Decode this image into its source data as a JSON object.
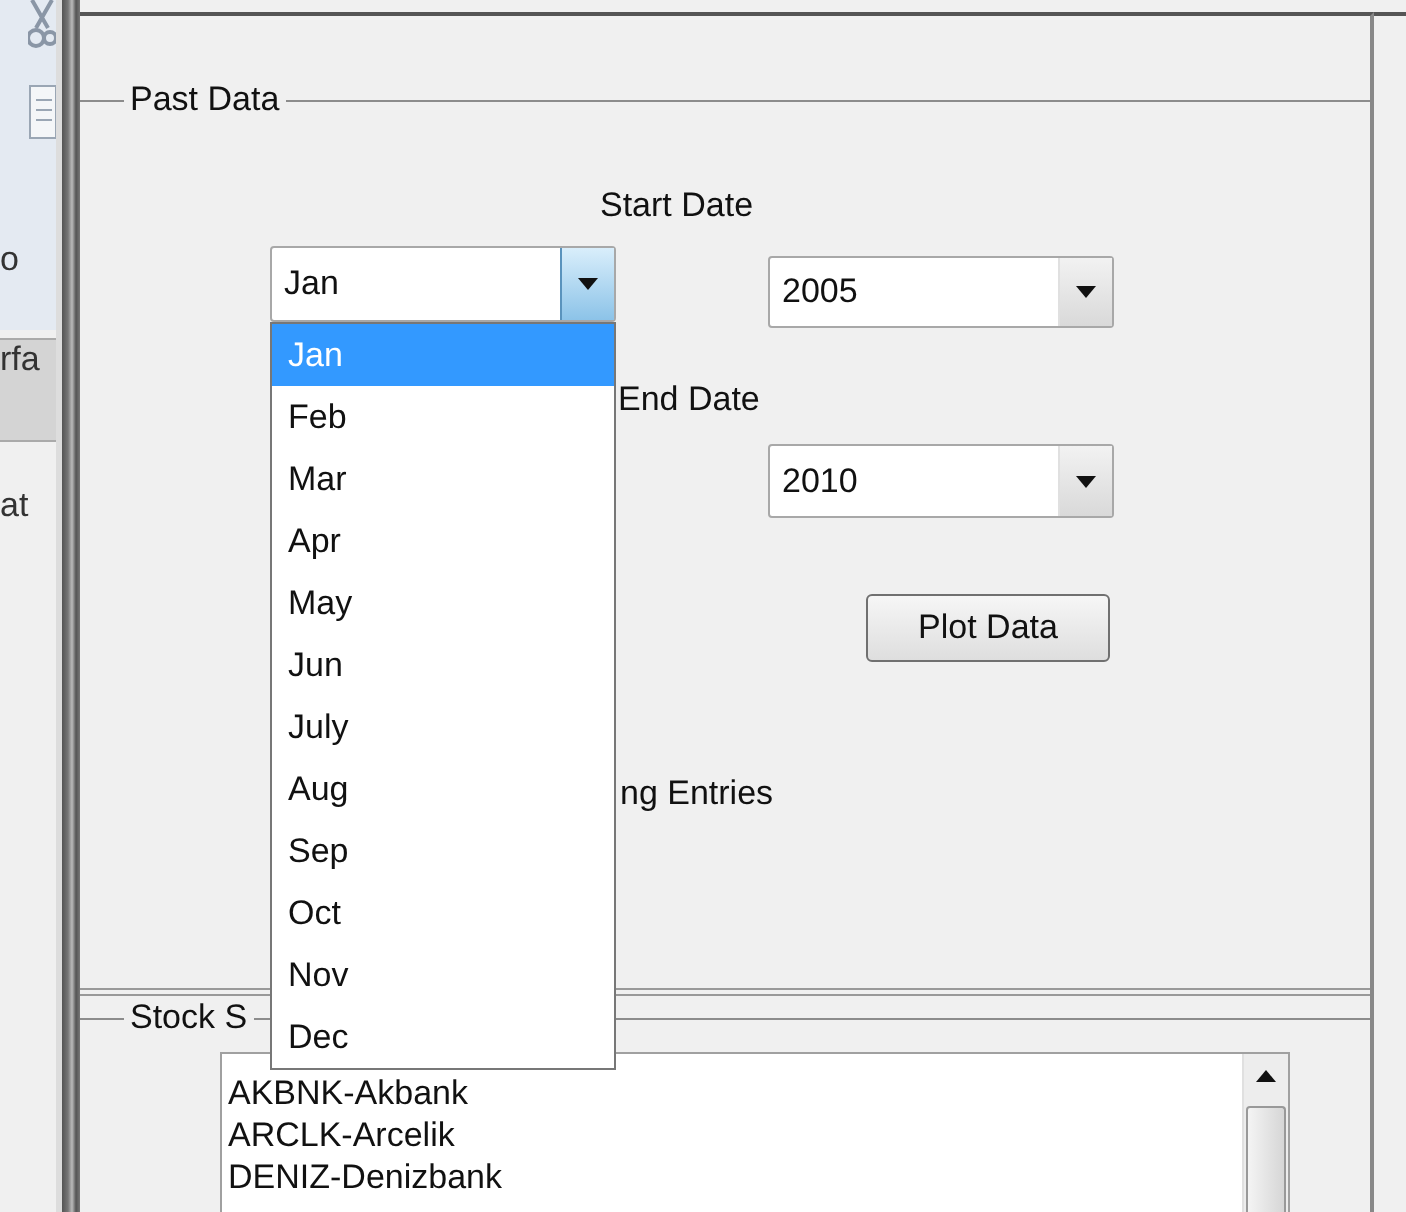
{
  "background_window": {
    "labels": [
      "o",
      "rfa",
      "at"
    ]
  },
  "past_data": {
    "title": "Past Data",
    "start_date_label": "Start Date",
    "start_month": {
      "value": "Jan",
      "open": true,
      "options": [
        {
          "label": "Jan",
          "selected": true
        },
        {
          "label": "Feb",
          "selected": false
        },
        {
          "label": "Mar",
          "selected": false
        },
        {
          "label": "Apr",
          "selected": false
        },
        {
          "label": "May",
          "selected": false
        },
        {
          "label": "Jun",
          "selected": false
        },
        {
          "label": "July",
          "selected": false
        },
        {
          "label": "Aug",
          "selected": false
        },
        {
          "label": "Sep",
          "selected": false
        },
        {
          "label": "Oct",
          "selected": false
        },
        {
          "label": "Nov",
          "selected": false
        },
        {
          "label": "Dec",
          "selected": false
        }
      ]
    },
    "start_year": {
      "value": "2005",
      "open": false
    },
    "end_date_label": "End Date",
    "end_year": {
      "value": "2010",
      "open": false
    },
    "plot_button": "Plot Data",
    "entries_label": "ng Entries"
  },
  "stock_selection": {
    "title": "Stock S",
    "stocks": [
      "AKBNK-Akbank",
      "ARCLK-Arcelik",
      "DENIZ-Denizbank"
    ]
  }
}
